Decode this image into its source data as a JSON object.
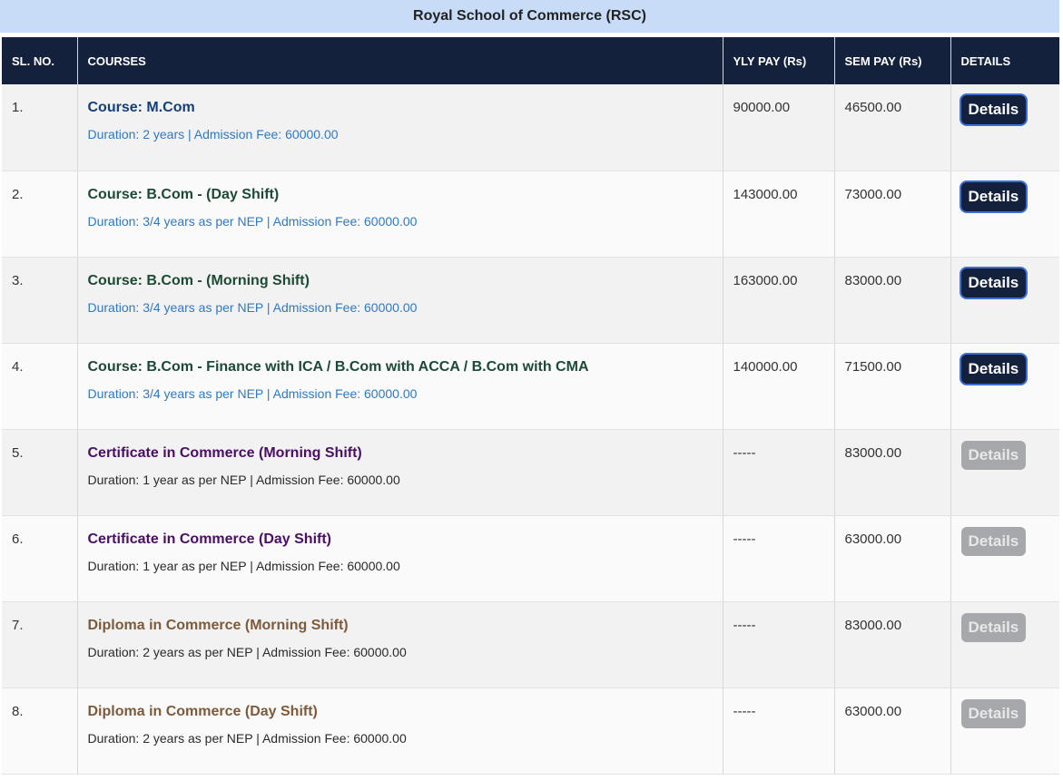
{
  "header": {
    "title": "Royal School of Commerce (RSC)"
  },
  "table": {
    "columns": [
      "SL. NO.",
      "COURSES",
      "YLY PAY (Rs)",
      "SEM PAY (Rs)",
      "DETAILS"
    ],
    "rows": [
      {
        "sl": "1.",
        "course": "Course: M.Com",
        "info": "Duration: 2 years | Admission Fee: 60000.00",
        "yly": "90000.00",
        "sem": "46500.00",
        "details": "Details"
      },
      {
        "sl": "2.",
        "course": "Course: B.Com - (Day Shift)",
        "info": "Duration: 3/4 years as per NEP | Admission Fee: 60000.00",
        "yly": "143000.00",
        "sem": "73000.00",
        "details": "Details"
      },
      {
        "sl": "3.",
        "course": "Course: B.Com - (Morning Shift)",
        "info": "Duration: 3/4 years as per NEP | Admission Fee: 60000.00",
        "yly": "163000.00",
        "sem": "83000.00",
        "details": "Details"
      },
      {
        "sl": "4.",
        "course": "Course: B.Com - Finance with ICA / B.Com with ACCA / B.Com with CMA",
        "info": "Duration: 3/4 years as per NEP | Admission Fee: 60000.00",
        "yly": "140000.00",
        "sem": "71500.00",
        "details": "Details"
      },
      {
        "sl": "5.",
        "course": "Certificate in Commerce (Morning Shift)",
        "info": "Duration: 1 year as per NEP | Admission Fee: 60000.00",
        "yly": "-----",
        "sem": "83000.00",
        "details": "Details"
      },
      {
        "sl": "6.",
        "course": "Certificate in Commerce (Day Shift)",
        "info": "Duration: 1 year as per NEP | Admission Fee: 60000.00",
        "yly": "-----",
        "sem": "63000.00",
        "details": "Details"
      },
      {
        "sl": "7.",
        "course": "Diploma in Commerce (Morning Shift)",
        "info": "Duration: 2 years as per NEP | Admission Fee: 60000.00",
        "yly": "-----",
        "sem": "83000.00",
        "details": "Details"
      },
      {
        "sl": "8.",
        "course": "Diploma in Commerce (Day Shift)",
        "info": "Duration: 2 years as per NEP | Admission Fee: 60000.00",
        "yly": "-----",
        "sem": "63000.00",
        "details": "Details"
      }
    ]
  },
  "colors": {
    "header_bg": "#14213d",
    "title_bg": "#c8dcf8",
    "active_button": "#14213d",
    "disabled_button": "#a6a8ab"
  }
}
